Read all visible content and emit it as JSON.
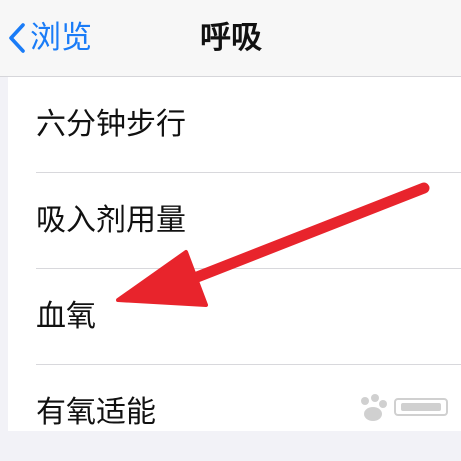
{
  "nav": {
    "back_label": "浏览",
    "title": "呼吸"
  },
  "list": {
    "items": [
      {
        "label": "六分钟步行"
      },
      {
        "label": "吸入剂用量"
      },
      {
        "label": "血氧"
      },
      {
        "label": "有氧适能"
      }
    ]
  },
  "colors": {
    "accent": "#1a7cf7",
    "arrow": "#e8242c",
    "background": "#f2f2f7",
    "row_background": "#ffffff"
  },
  "icons": {
    "back": "chevron-left-icon"
  }
}
